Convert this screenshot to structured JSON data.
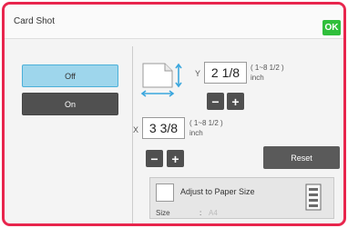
{
  "window": {
    "title": "Card Shot",
    "ok_label": "OK"
  },
  "mode": {
    "off_label": "Off",
    "on_label": "On",
    "selected": "Off"
  },
  "y_dimension": {
    "axis": "Y",
    "value": "2 1/8",
    "range": "( 1~8 1/2 )",
    "unit": "inch"
  },
  "x_dimension": {
    "axis": "X",
    "value": "3 3/8",
    "range": "( 1~8 1/2 )",
    "unit": "inch"
  },
  "stepper": {
    "minus": "−",
    "plus": "+"
  },
  "reset_label": "Reset",
  "adjust": {
    "label": "Adjust to Paper Size",
    "checked": false,
    "size_label": "Size",
    "size_separator": ":",
    "size_value": "A4"
  },
  "colors": {
    "frame_border": "#e8254d",
    "ok_green": "#2fbf3b",
    "selected_blue": "#9ed6ec",
    "dark_button": "#505050",
    "arrow_blue": "#3aa6dd"
  }
}
